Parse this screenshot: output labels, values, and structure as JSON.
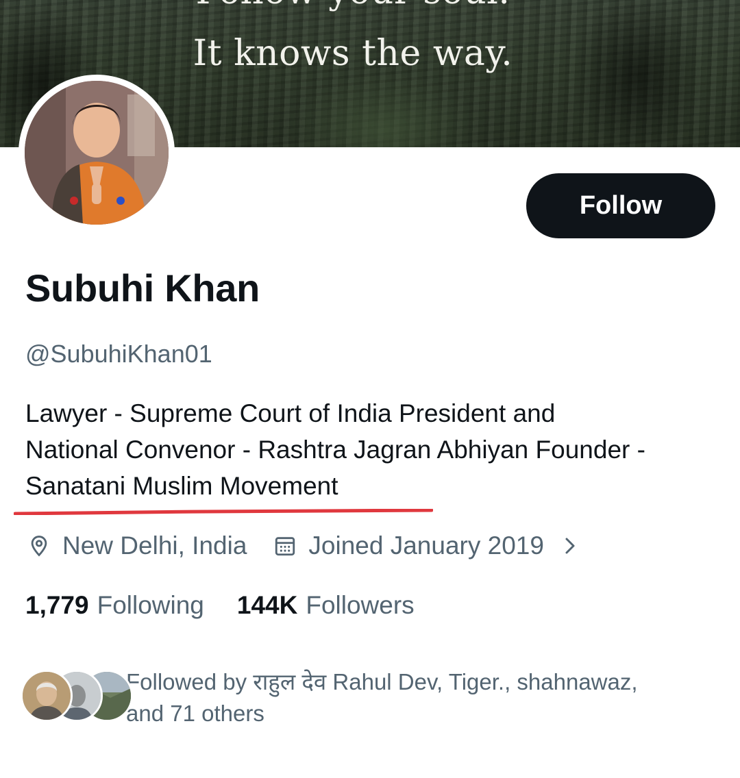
{
  "banner": {
    "quote_line1": "Follow your soul.",
    "quote_line2": "It knows the way."
  },
  "profile": {
    "display_name": "Subuhi Khan",
    "handle": "@SubuhiKhan01",
    "bio_lines": [
      "Lawyer - Supreme Court of India President and",
      "National Convenor - Rashtra Jagran Abhiyan Founder -",
      "Sanatani Muslim Movement"
    ],
    "location": "New Delhi, India",
    "joined": "Joined January 2019"
  },
  "actions": {
    "follow_label": "Follow"
  },
  "stats": {
    "following_count": "1,779",
    "following_label": "Following",
    "followers_count": "144K",
    "followers_label": "Followers"
  },
  "followed_by": {
    "text_line1": "Followed by राहुल देव Rahul Dev, Tiger., shahnawaz,",
    "text_line2": "and 71 others"
  },
  "icons": {
    "location": "location-pin-icon",
    "joined": "calendar-icon",
    "more": "chevron-right-icon"
  },
  "colors": {
    "text_primary": "#0f1419",
    "text_secondary": "#536471",
    "button_bg": "#0f1419",
    "underline_annotation": "#e0383e"
  }
}
